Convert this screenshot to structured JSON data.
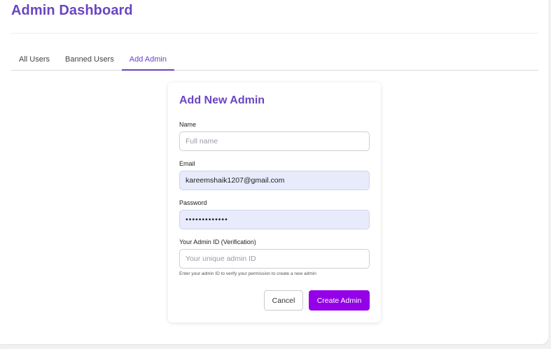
{
  "header": {
    "title": "Admin Dashboard"
  },
  "tabs": [
    {
      "label": "All Users",
      "active": false
    },
    {
      "label": "Banned Users",
      "active": false
    },
    {
      "label": "Add Admin",
      "active": true
    }
  ],
  "form": {
    "title": "Add New Admin",
    "name": {
      "label": "Name",
      "value": "",
      "placeholder": "Full name"
    },
    "email": {
      "label": "Email",
      "value": "kareemshaik1207@gmail.com",
      "placeholder": ""
    },
    "password": {
      "label": "Password",
      "value": "•••••••••••••",
      "placeholder": ""
    },
    "admin_id": {
      "label": "Your Admin ID (Verification)",
      "value": "",
      "placeholder": "Your unique admin ID",
      "hint": "Enter your admin ID to verify your permission to create a new admin"
    },
    "cancel_label": "Cancel",
    "submit_label": "Create Admin"
  },
  "colors": {
    "accent": "#6a45c2",
    "primary_button": "#9400e8",
    "filled_field": "#e8ebfc"
  }
}
